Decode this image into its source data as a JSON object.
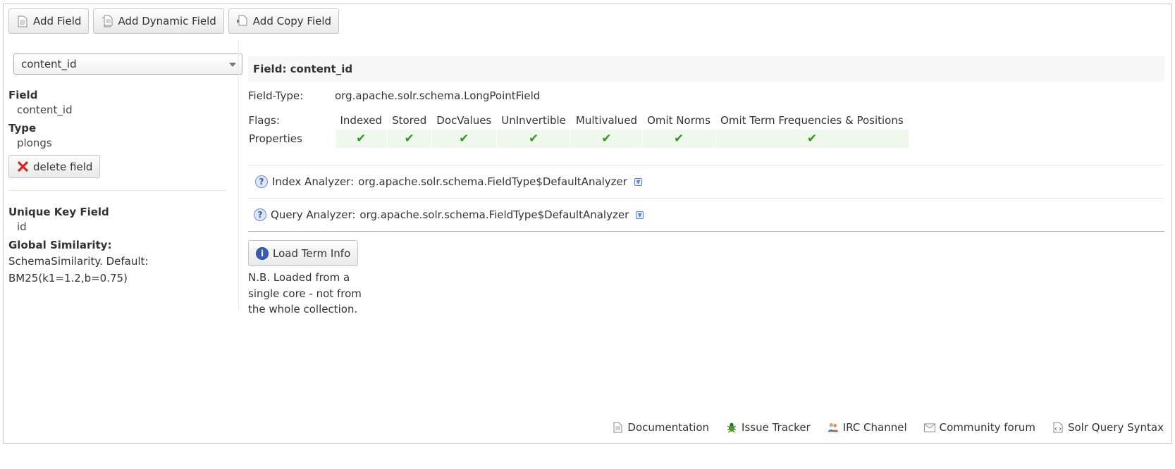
{
  "toolbar": {
    "add_field": "Add Field",
    "add_dynamic_field": "Add Dynamic Field",
    "add_copy_field": "Add Copy Field"
  },
  "sidebar": {
    "selected_field": "content_id",
    "field_label": "Field",
    "field_value": "content_id",
    "type_label": "Type",
    "type_value": "plongs",
    "delete_button": "delete field",
    "unique_key_label": "Unique Key Field",
    "unique_key_value": "id",
    "similarity_label": "Global Similarity:",
    "similarity_line1": "SchemaSimilarity. Default:",
    "similarity_line2": "BM25(k1=1.2,b=0.75)"
  },
  "main": {
    "title": "Field: content_id",
    "field_type_label": "Field-Type:",
    "field_type_value": "org.apache.solr.schema.LongPointField",
    "flags_label": "Flags:",
    "properties_label": "Properties",
    "flags": [
      "Indexed",
      "Stored",
      "DocValues",
      "UnInvertible",
      "Multivalued",
      "Omit Norms",
      "Omit Term Frequencies & Positions"
    ],
    "properties_checked": [
      true,
      true,
      true,
      true,
      true,
      true,
      true
    ],
    "index_analyzer_label": "Index Analyzer:",
    "index_analyzer_value": "org.apache.solr.schema.FieldType$DefaultAnalyzer",
    "query_analyzer_label": "Query Analyzer:",
    "query_analyzer_value": "org.apache.solr.schema.FieldType$DefaultAnalyzer",
    "load_term_button": "Load Term Info",
    "note_line1": "N.B. Loaded from a",
    "note_line2": "single core - not from",
    "note_line3": "the whole collection."
  },
  "footer": {
    "documentation": "Documentation",
    "issue_tracker": "Issue Tracker",
    "irc_channel": "IRC Channel",
    "community_forum": "Community forum",
    "query_syntax": "Solr Query Syntax"
  },
  "colors": {
    "check": "#2e9a1f",
    "delete": "#d3261c",
    "info": "#3a5bb4"
  }
}
